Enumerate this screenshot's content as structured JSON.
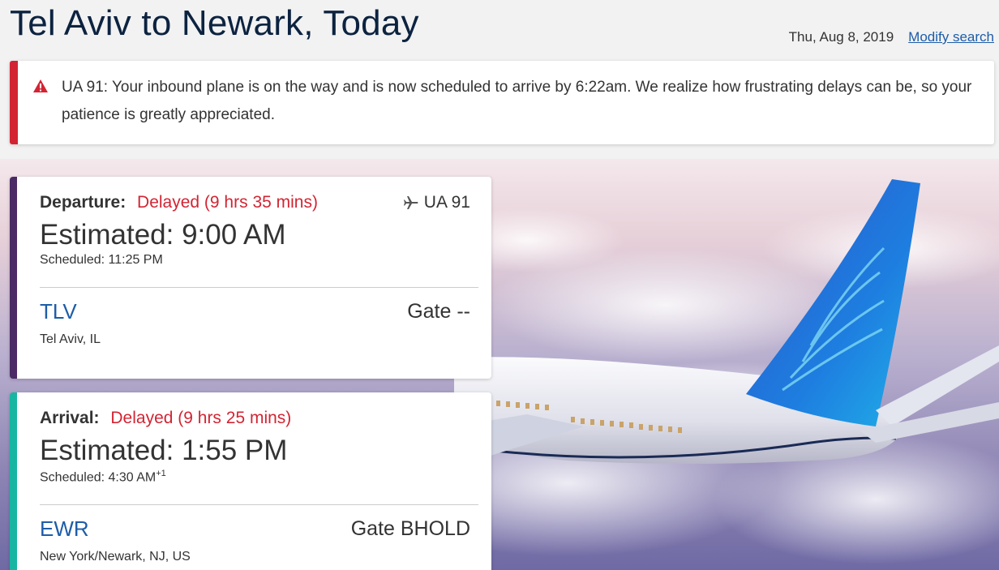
{
  "header": {
    "title": "Tel Aviv to Newark, Today",
    "date": "Thu, Aug 8, 2019",
    "modify_label": "Modify search"
  },
  "alert": {
    "icon": "warning-triangle-icon",
    "message": "UA 91: Your inbound plane is on the way and is now scheduled to arrive by 6:22am. We realize how frustrating delays can be, so your patience is greatly appreciated.",
    "color": "#d32433"
  },
  "departure": {
    "label": "Departure:",
    "status": "Delayed (9 hrs 35 mins)",
    "flight_number": "UA 91",
    "estimated": "Estimated: 9:00 AM",
    "scheduled": "Scheduled: 11:25 PM",
    "airport_code": "TLV",
    "gate": "Gate --",
    "city": "Tel Aviv, IL",
    "accent_color": "#4b2a66"
  },
  "arrival": {
    "label": "Arrival:",
    "status": "Delayed (9 hrs 25 mins)",
    "estimated": "Estimated: 1:55 PM",
    "scheduled": "Scheduled: 4:30 AM",
    "scheduled_day_offset": "+1",
    "airport_code": "EWR",
    "gate": "Gate BHOLD",
    "city": "New York/Newark, NJ, US",
    "accent_color": "#18b5a3"
  },
  "colors": {
    "status_delayed": "#d32433",
    "link": "#1d5da8",
    "title": "#0c2340"
  }
}
